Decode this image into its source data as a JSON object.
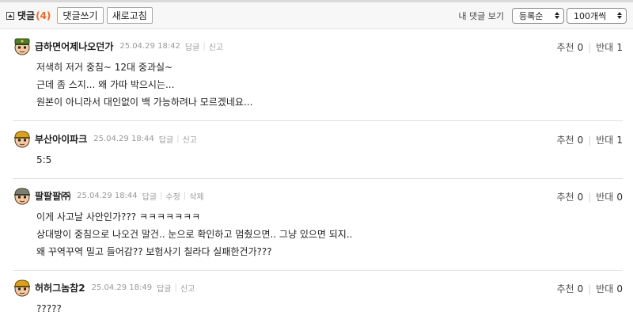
{
  "toolbar": {
    "title": "댓글",
    "count": "(4)",
    "write_label": "댓글쓰기",
    "refresh_label": "새로고침",
    "my_comments_label": "내 댓글 보기",
    "sort_value": "등록순",
    "page_size_value": "100개씩"
  },
  "vote_labels": {
    "up": "추천",
    "down": "반대"
  },
  "comments": [
    {
      "nickname": "급하면어제나오던가",
      "date": "25.04.29 18:42",
      "actions": [
        "답글",
        "신고"
      ],
      "up": "0",
      "down": "1",
      "lines": [
        "저색히 저거 중침~ 12대 중과실~",
        "근데 좀 스지... 왜 가따 박으시는...",
        "원본이 아니라서 대인없이 백 가능하려나 모르겠네요..."
      ],
      "avatar": "soldier-green-icon"
    },
    {
      "nickname": "부산아이파크",
      "date": "25.04.29 18:44",
      "actions": [
        "답글",
        "신고"
      ],
      "up": "0",
      "down": "1",
      "lines": [
        "5:5"
      ],
      "avatar": "soldier-gold-icon"
    },
    {
      "nickname": "팔팔팔㈜",
      "date": "25.04.29 18:44",
      "actions": [
        "답글",
        "수정",
        "삭제"
      ],
      "up": "0",
      "down": "0",
      "lines": [
        "이게 사고날 사안인가??? ㅋㅋㅋㅋㅋㅋㅋ",
        "상대방이 중침으로 나오건 말건.. 눈으로 확인하고 멈췄으면.. 그냥 있으면 되지..",
        "왜 꾸역꾸역 밀고 들어감?? 보험사기 칠라다 실패한건가???"
      ],
      "avatar": "soldier-gray-icon"
    },
    {
      "nickname": "허허그놈참2",
      "date": "25.04.29 18:49",
      "actions": [
        "답글",
        "신고"
      ],
      "up": "0",
      "down": "0",
      "lines": [
        "?????"
      ],
      "avatar": "soldier-gold-icon"
    }
  ]
}
